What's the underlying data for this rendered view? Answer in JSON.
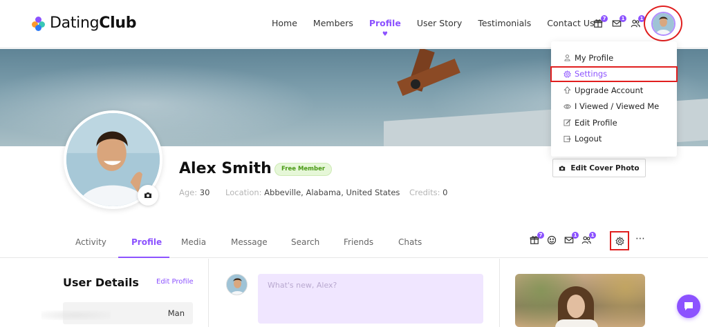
{
  "brand": {
    "name_light": "Dating",
    "name_bold": "Club"
  },
  "nav": {
    "items": [
      {
        "label": "Home",
        "active": false
      },
      {
        "label": "Members",
        "active": false
      },
      {
        "label": "Profile",
        "active": true
      },
      {
        "label": "User Story",
        "active": false
      },
      {
        "label": "Testimonials",
        "active": false
      },
      {
        "label": "Contact Us",
        "active": false
      }
    ]
  },
  "header_icons": [
    {
      "icon": "gift-icon",
      "badge": "7"
    },
    {
      "icon": "mail-icon",
      "badge": "1"
    },
    {
      "icon": "friends-icon",
      "badge": "1"
    }
  ],
  "dropdown": {
    "items": [
      {
        "icon": "user-icon",
        "label": "My Profile"
      },
      {
        "icon": "gear-icon",
        "label": "Settings",
        "active": true
      },
      {
        "icon": "upgrade-icon",
        "label": "Upgrade Account"
      },
      {
        "icon": "eye-icon",
        "label": "I Viewed / Viewed Me"
      },
      {
        "icon": "edit-icon",
        "label": "Edit Profile"
      },
      {
        "icon": "logout-icon",
        "label": "Logout"
      }
    ]
  },
  "profile": {
    "name": "Alex Smith",
    "badge": "Free Member",
    "age_label": "Age:",
    "age": "30",
    "location_label": "Location:",
    "location": "Abbeville, Alabama, United States",
    "credits_label": "Credits:",
    "credits": "0",
    "edit_cover_label": "Edit Cover Photo"
  },
  "tabs": [
    {
      "label": "Activity",
      "active": false
    },
    {
      "label": "Profile",
      "active": true
    },
    {
      "label": "Media",
      "active": false
    },
    {
      "label": "Message",
      "active": false
    },
    {
      "label": "Search",
      "active": false
    },
    {
      "label": "Friends",
      "active": false
    },
    {
      "label": "Chats",
      "active": false
    }
  ],
  "sub_icons": [
    {
      "icon": "gift-icon",
      "badge": "7"
    },
    {
      "icon": "smiley-icon",
      "badge": ""
    },
    {
      "icon": "mail-icon",
      "badge": "1"
    },
    {
      "icon": "friends-icon",
      "badge": "1"
    }
  ],
  "user_details": {
    "title": "User Details",
    "edit_label": "Edit Profile",
    "gender_value": "Man"
  },
  "post": {
    "placeholder": "What's new, Alex?"
  },
  "colors": {
    "accent": "#8c52ff",
    "highlight": "#e01e1e",
    "badge_green": "#4a9a16"
  }
}
